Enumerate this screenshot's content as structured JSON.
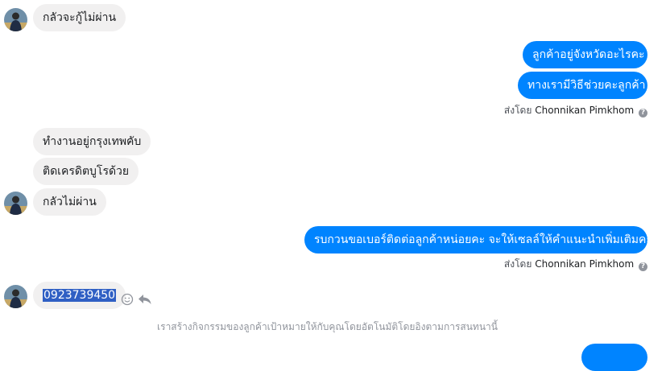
{
  "conversation": {
    "messages": [
      {
        "id": "m1",
        "direction": "incoming",
        "text": "กลัวจะกู้ไม่ผ่าน"
      },
      {
        "id": "m2",
        "direction": "outgoing",
        "text": "ลูกค้าอยู่จังหวัดอะไรคะ"
      },
      {
        "id": "m3",
        "direction": "outgoing",
        "text": "ทางเรามีวิธีช่วยคะลูกค้า"
      },
      {
        "id": "m4",
        "direction": "incoming",
        "text": "ทำงานอยู่กรุงเทพคับ"
      },
      {
        "id": "m5",
        "direction": "incoming",
        "text": "ติดเครดิตบูโรด้วย"
      },
      {
        "id": "m6",
        "direction": "incoming",
        "text": "กลัวไม่ผ่าน"
      },
      {
        "id": "m7",
        "direction": "outgoing",
        "text": "รบกวนขอเบอร์ติดต่อลูกค้าหน่อยคะ จะให้เซลล์ให้คำแนะนำเพิ่มเติมคะ"
      },
      {
        "id": "m8",
        "direction": "incoming",
        "text": "0923739450",
        "selected": true
      }
    ],
    "sent_by": {
      "prefix": "ส่งโดย",
      "sender_name": "Chonnikan Pimkhom",
      "help_icon": "question-circle-icon",
      "help_glyph": "?"
    },
    "message_actions": {
      "react_icon": "smiley-icon",
      "reply_icon": "reply-icon"
    },
    "notice": "เราสร้างกิจกรรมของลูกค้าเป้าหมายให้กับคุณโดยอัตโนมัติโดยอิงตามการสนทนานี้"
  },
  "colors": {
    "outgoing_bubble": "#0084ff",
    "incoming_bubble": "#f1f0f0",
    "selection": "#2f5fc4",
    "muted_text": "#90949c"
  }
}
